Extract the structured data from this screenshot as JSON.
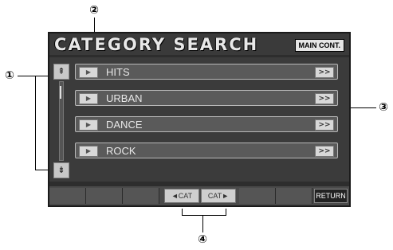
{
  "screen": {
    "title": "CATEGORY SEARCH",
    "main_cont_label": "MAIN CONT.",
    "rows": [
      {
        "label": "HITS"
      },
      {
        "label": "URBAN"
      },
      {
        "label": "DANCE"
      },
      {
        "label": "ROCK"
      }
    ],
    "play_icon": "play-icon",
    "more_icon_label": ">>",
    "cat_prev_label": "◄CAT",
    "cat_next_label": "CAT►",
    "return_label": "RETURN",
    "scroll_up_icon": "scroll-up-icon",
    "scroll_down_icon": "scroll-down-icon"
  },
  "callouts": {
    "c1": "①",
    "c2": "②",
    "c3": "③",
    "c4": "④"
  }
}
